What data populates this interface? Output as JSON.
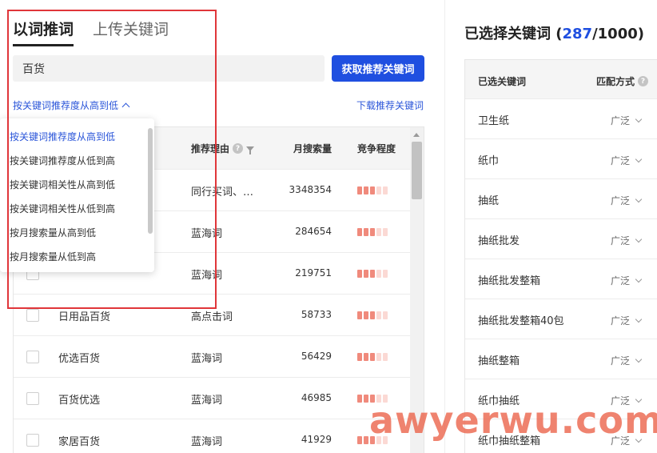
{
  "tabs": [
    {
      "label": "以词推词",
      "active": true
    },
    {
      "label": "上传关键词",
      "active": false
    }
  ],
  "search": {
    "value": "百货"
  },
  "fetch_button": "获取推荐关键词",
  "sort": {
    "current": "按关键词推荐度从高到低"
  },
  "download_link": "下载推荐关键词",
  "dropdown": {
    "options": [
      "按关键词推荐度从高到低",
      "按关键词推荐度从低到高",
      "按关键词相关性从高到低",
      "按关键词相关性从低到高",
      "按月搜索量从高到低",
      "按月搜索量从低到高"
    ],
    "selected_index": 0
  },
  "table": {
    "headers": {
      "reason": "推荐理由",
      "volume": "月搜索量",
      "competition": "竞争程度"
    },
    "rows": [
      {
        "keyword": "",
        "reason": "同行买词、…",
        "volume": "3348354",
        "competition": 3
      },
      {
        "keyword": "",
        "reason": "蓝海词",
        "volume": "284654",
        "competition": 3
      },
      {
        "keyword": "",
        "reason": "蓝海词",
        "volume": "219751",
        "competition": 3
      },
      {
        "keyword": "日用品百货",
        "reason": "高点击词",
        "volume": "58733",
        "competition": 3
      },
      {
        "keyword": "优选百货",
        "reason": "蓝海词",
        "volume": "56429",
        "competition": 3
      },
      {
        "keyword": "百货优选",
        "reason": "蓝海词",
        "volume": "46985",
        "competition": 3
      },
      {
        "keyword": "家居百货",
        "reason": "蓝海词",
        "volume": "41929",
        "competition": 3
      }
    ]
  },
  "selected": {
    "title_prefix": "已选择关键词 (",
    "count": "287",
    "title_suffix": "/1000)",
    "headers": {
      "keyword": "已选关键词",
      "match": "匹配方式"
    },
    "rows": [
      {
        "keyword": "卫生纸",
        "match": "广泛"
      },
      {
        "keyword": "纸巾",
        "match": "广泛"
      },
      {
        "keyword": "抽纸",
        "match": "广泛"
      },
      {
        "keyword": "抽纸批发",
        "match": "广泛"
      },
      {
        "keyword": "抽纸批发整箱",
        "match": "广泛"
      },
      {
        "keyword": "抽纸批发整箱40包",
        "match": "广泛"
      },
      {
        "keyword": "抽纸整箱",
        "match": "广泛"
      },
      {
        "keyword": "纸巾抽纸",
        "match": "广泛"
      },
      {
        "keyword": "纸巾抽纸整箱",
        "match": "广泛"
      }
    ]
  },
  "watermark": "awyerwu.com",
  "colors": {
    "accent": "#1f4fe0",
    "link": "#2a55d9",
    "highlight_border": "#e0363a",
    "comp_high": "#f08a7c",
    "comp_low": "#fbd9d4"
  }
}
